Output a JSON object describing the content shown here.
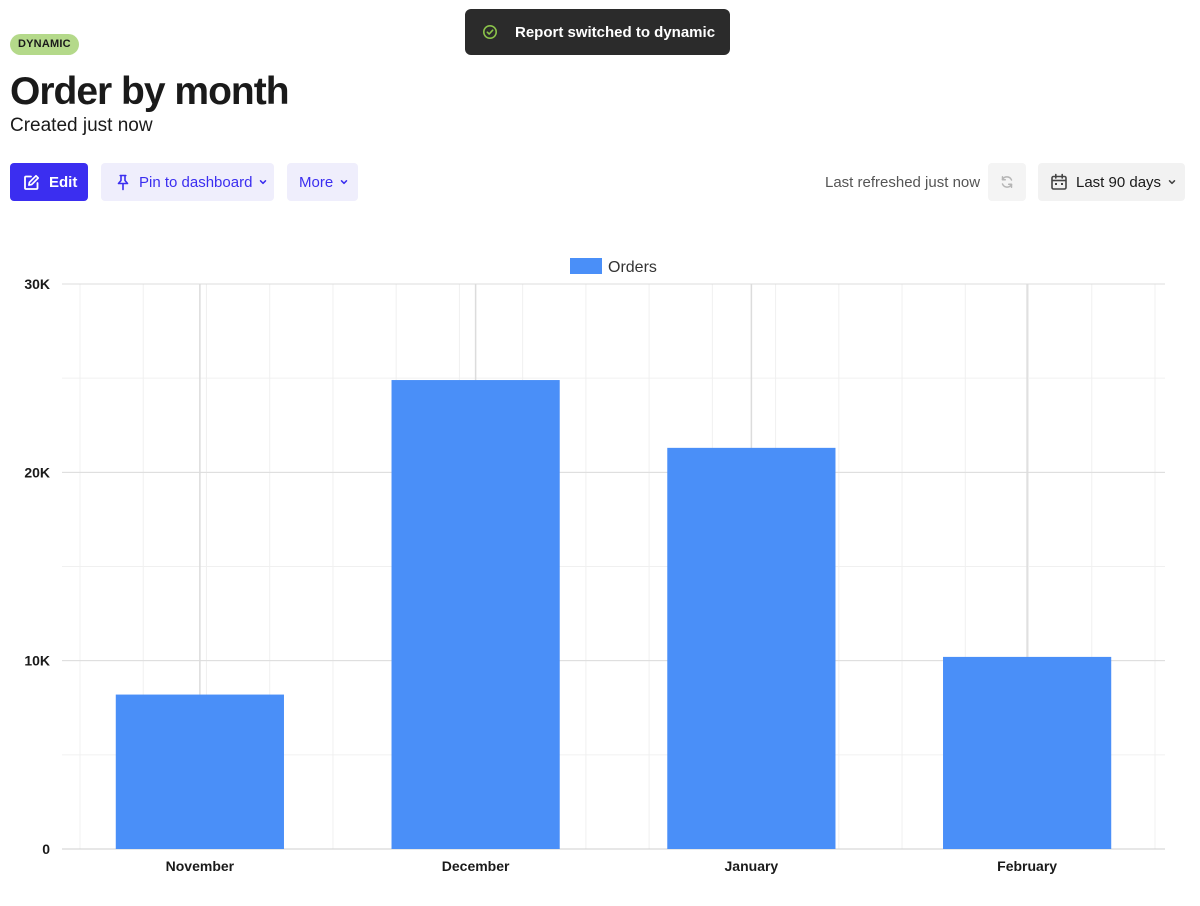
{
  "toast": {
    "message": "Report switched to dynamic",
    "icon": "check-circle-icon"
  },
  "report": {
    "badge": "DYNAMIC",
    "title": "Order by month",
    "subtitle": "Created just now"
  },
  "toolbar": {
    "edit_label": "Edit",
    "pin_label": "Pin to dashboard",
    "more_label": "More",
    "last_refreshed": "Last refreshed just now",
    "date_range": "Last 90 days"
  },
  "colors": {
    "accent": "#3b2ef0",
    "bar": "#4a8ff8",
    "badge_bg": "#b4d98a",
    "toast_bg": "#2b2b2b",
    "toast_icon": "#8bc34a"
  },
  "chart_data": {
    "type": "bar",
    "categories": [
      "November",
      "December",
      "January",
      "February"
    ],
    "series": [
      {
        "name": "Orders",
        "values": [
          8200,
          24900,
          21300,
          10200
        ]
      }
    ],
    "ylim": [
      0,
      30000
    ],
    "yticks": [
      0,
      10000,
      20000,
      30000
    ],
    "ytick_labels": [
      "0",
      "10K",
      "20K",
      "30K"
    ],
    "legend_position": "top-center",
    "grid": true
  }
}
